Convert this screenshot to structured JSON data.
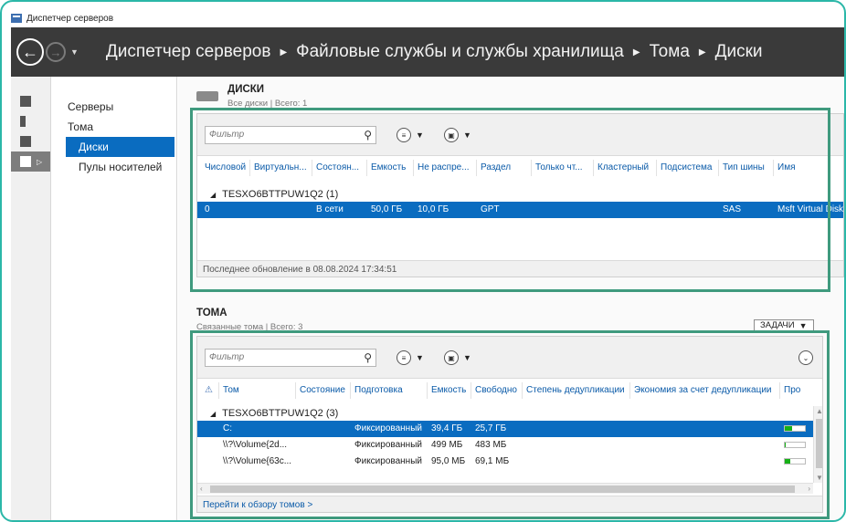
{
  "window": {
    "title": "Диспетчер серверов"
  },
  "breadcrumb": [
    "Диспетчер серверов",
    "Файловые службы и службы хранилища",
    "Тома",
    "Диски"
  ],
  "sidebar": {
    "items": [
      {
        "label": "Серверы"
      },
      {
        "label": "Тома"
      },
      {
        "label": "Диски"
      },
      {
        "label": "Пулы носителей"
      }
    ]
  },
  "disks": {
    "title": "ДИСКИ",
    "subtitle": "Все диски | Всего: 1",
    "filter_placeholder": "Фильтр",
    "columns": [
      "Числовой",
      "Виртуальн...",
      "Состоян...",
      "Емкость",
      "Не распре...",
      "Раздел",
      "Только чт...",
      "Кластерный",
      "Подсистема",
      "Тип шины",
      "Имя"
    ],
    "group": "TESXO6BTTPUW1Q2 (1)",
    "rows": [
      [
        "0",
        "",
        "В сети",
        "50,0 ГБ",
        "10,0 ГБ",
        "GPT",
        "",
        "",
        "",
        "SAS",
        "Msft Virtual Disk"
      ]
    ],
    "footer": "Последнее обновление в 08.08.2024 17:34:51"
  },
  "volumes": {
    "title": "ТОМА",
    "subtitle": "Связанные тома | Всего: 3",
    "tasks_label": "ЗАДАЧИ",
    "filter_placeholder": "Фильтр",
    "columns": [
      "Том",
      "Состояние",
      "Подготовка",
      "Емкость",
      "Свободно",
      "Степень дедупликации",
      "Экономия за счет дедупликации",
      "Про"
    ],
    "group": "TESXO6BTTPUW1Q2 (3)",
    "rows": [
      {
        "cells": [
          "C:",
          "",
          "Фиксированный",
          "39,4 ГБ",
          "25,7 ГБ",
          "",
          ""
        ],
        "used_fraction": 0.35
      },
      {
        "cells": [
          "\\\\?\\Volume{2d...",
          "",
          "Фиксированный",
          "499 МБ",
          "483 МБ",
          "",
          ""
        ],
        "used_fraction": 0.03
      },
      {
        "cells": [
          "\\\\?\\Volume{63c...",
          "",
          "Фиксированный",
          "95,0 МБ",
          "69,1 МБ",
          "",
          ""
        ],
        "used_fraction": 0.27
      }
    ],
    "footer_link": "Перейти к обзору томов >"
  },
  "colors": {
    "accent": "#0a6cc0",
    "nav_bar": "#3a3a3a",
    "highlight_box": "#3f9a7e",
    "progress": "#16b116"
  }
}
